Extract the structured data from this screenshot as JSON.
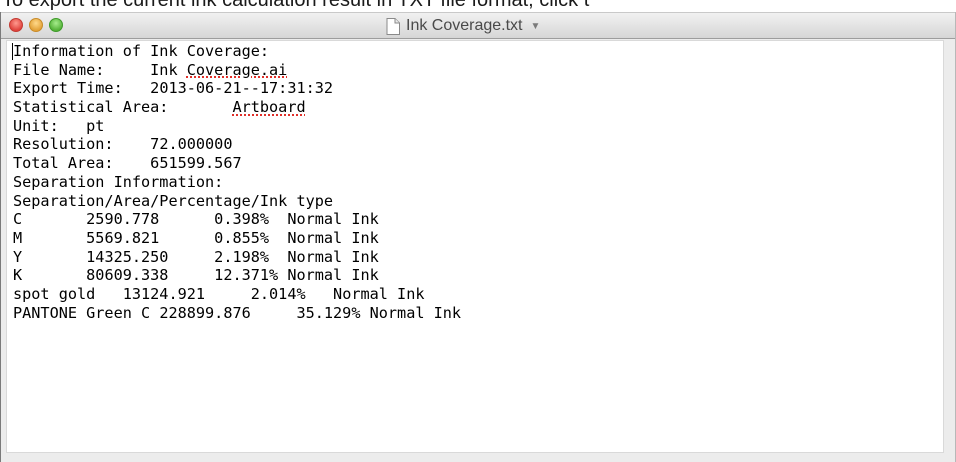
{
  "caption": "To export the current ink calculation result in TXT file format, click t",
  "window": {
    "title": "Ink Coverage.txt",
    "title_chevron": "▼",
    "doc_icon": "document-icon",
    "traffic_colors": {
      "close": "#e0443e",
      "minimize": "#e3a33a",
      "maximize": "#56b33a"
    }
  },
  "document": {
    "header": "Information of Ink Coverage:",
    "file_name": {
      "label": "File Name:",
      "value": "Ink Coverage.ai",
      "value_prefix": "Ink ",
      "value_misspelled": "Coverage.ai"
    },
    "export_time": {
      "label": "Export Time:",
      "value": "2013-06-21--17:31:32"
    },
    "statistical_area": {
      "label": "Statistical Area:",
      "value": "Artboard"
    },
    "unit": {
      "label": "Unit:",
      "value": "pt"
    },
    "resolution": {
      "label": "Resolution:",
      "value": "72.000000"
    },
    "total_area": {
      "label": "Total Area:",
      "value": "651599.567"
    },
    "separation_header": "Separation Information:",
    "columns_header": "Separation/Area/Percentage/Ink type",
    "rows": [
      {
        "sep": "C",
        "area": "2590.778",
        "pct": "0.398%",
        "ink": "Normal Ink"
      },
      {
        "sep": "M",
        "area": "5569.821",
        "pct": "0.855%",
        "ink": "Normal Ink"
      },
      {
        "sep": "Y",
        "area": "14325.250",
        "pct": "2.198%",
        "ink": "Normal Ink"
      },
      {
        "sep": "K",
        "area": "80609.338",
        "pct": "12.371%",
        "ink": "Normal Ink"
      },
      {
        "sep": "spot gold",
        "area": "13124.921",
        "pct": "2.014%",
        "ink": "Normal Ink"
      },
      {
        "sep": "PANTONE Green C",
        "area": "228899.876",
        "pct": "35.129%",
        "ink": "Normal Ink"
      }
    ]
  }
}
